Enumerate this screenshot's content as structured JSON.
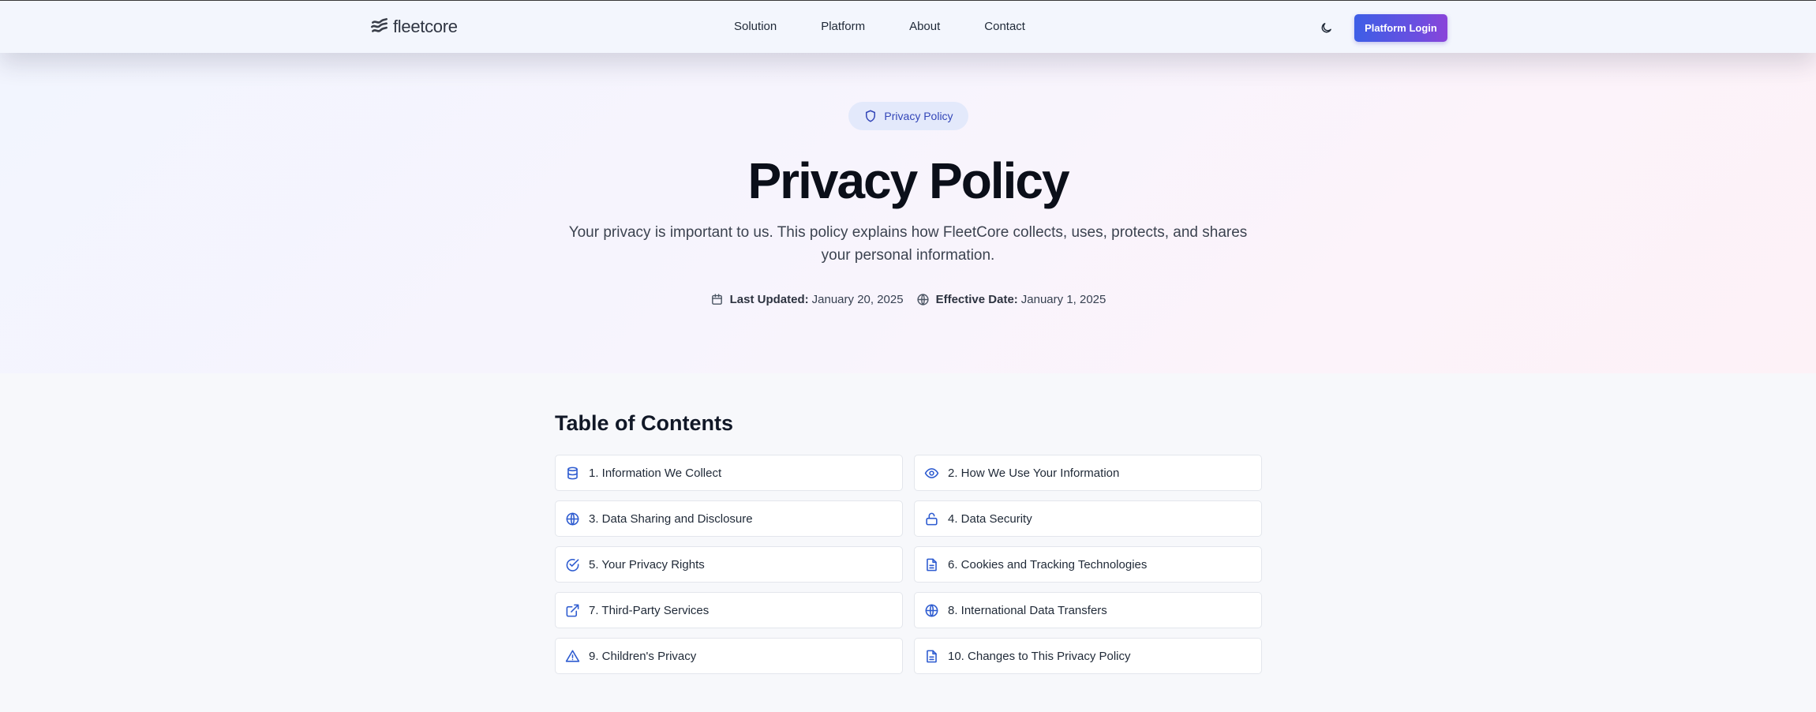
{
  "header": {
    "logo_text": "fleetcore",
    "nav": [
      "Solution",
      "Platform",
      "About",
      "Contact"
    ],
    "theme_icon": "moon-icon",
    "login_label": "Platform Login"
  },
  "hero": {
    "badge": "Privacy Policy",
    "title": "Privacy Policy",
    "description": "Your privacy is important to us. This policy explains how FleetCore collects, uses, protects, and shares your personal information.",
    "last_updated_label": "Last Updated:",
    "last_updated_value": "January 20, 2025",
    "effective_label": "Effective Date:",
    "effective_value": "January 1, 2025"
  },
  "toc": {
    "title": "Table of Contents",
    "items": [
      {
        "label": "1. Information We Collect",
        "icon": "database-icon"
      },
      {
        "label": "2. How We Use Your Information",
        "icon": "eye-icon"
      },
      {
        "label": "3. Data Sharing and Disclosure",
        "icon": "globe-icon"
      },
      {
        "label": "4. Data Security",
        "icon": "lock-icon"
      },
      {
        "label": "5. Your Privacy Rights",
        "icon": "check-circle-icon"
      },
      {
        "label": "6. Cookies and Tracking Technologies",
        "icon": "file-text-icon"
      },
      {
        "label": "7. Third-Party Services",
        "icon": "external-link-icon"
      },
      {
        "label": "8. International Data Transfers",
        "icon": "globe-icon"
      },
      {
        "label": "9. Children's Privacy",
        "icon": "warning-triangle-icon"
      },
      {
        "label": "10. Changes to This Privacy Policy",
        "icon": "file-text-icon"
      }
    ]
  },
  "colors": {
    "accent": "#2d5bd0",
    "login_gradient_start": "#3d5ee6",
    "login_gradient_end": "#8a44d9"
  }
}
